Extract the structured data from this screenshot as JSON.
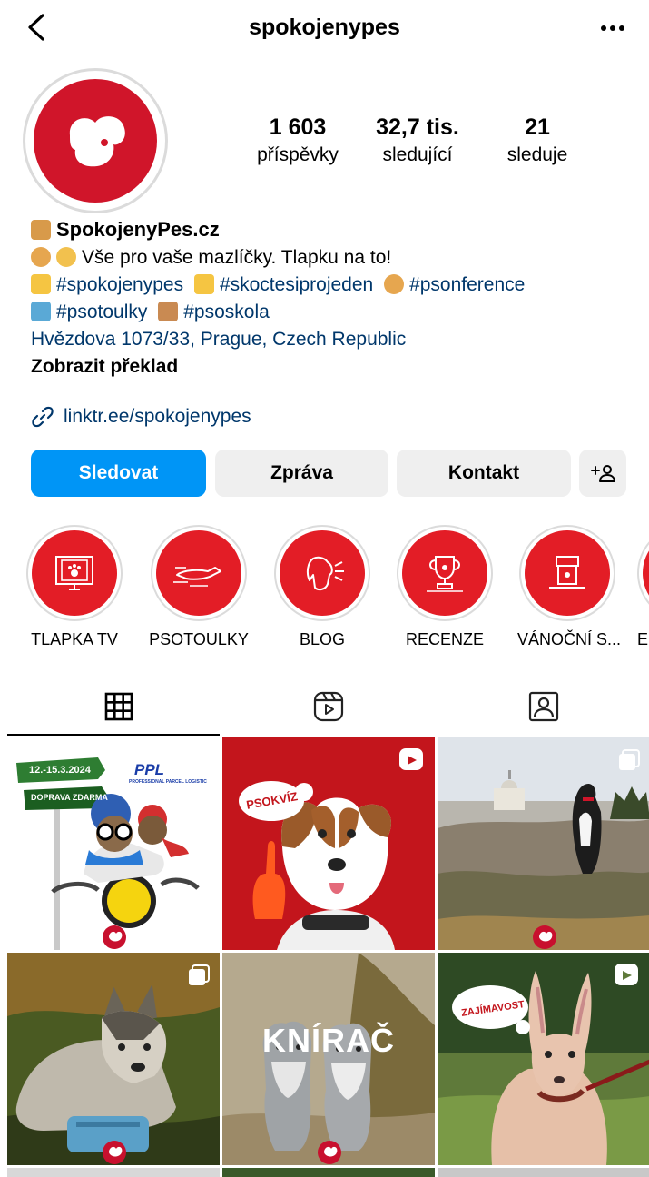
{
  "header": {
    "username": "spokojenypes"
  },
  "stats": [
    {
      "value": "1 603",
      "label": "příspěvky"
    },
    {
      "value": "32,7 tis.",
      "label": "sledující"
    },
    {
      "value": "21",
      "label": "sleduje"
    }
  ],
  "bio": {
    "name": "SpokojenyPes.cz",
    "line1": "Vše pro vaše mazlíčky. Tlapku na to!",
    "tag1": "#spokojenypes",
    "tag2": "#skoctesiprojeden",
    "tag3": "#psonference",
    "tag4": "#psotoulky",
    "tag5": "#psoskola",
    "address": "Hvězdova 1073/33, Prague, Czech Republic",
    "translate": "Zobrazit překlad",
    "link": "linktr.ee/spokojenypes"
  },
  "buttons": {
    "follow": "Sledovat",
    "message": "Zpráva",
    "contact": "Kontakt"
  },
  "highlights": [
    {
      "label": "TLAPKA TV",
      "icon": "tv-paw-icon"
    },
    {
      "label": "PSOTOULKY",
      "icon": "running-dog-icon"
    },
    {
      "label": "BLOG",
      "icon": "dog-head-icon"
    },
    {
      "label": "RECENZE",
      "icon": "trophy-icon"
    },
    {
      "label": "VÁNOČNÍ S...",
      "icon": "gift-box-icon"
    },
    {
      "label": "E",
      "icon": "partial-highlight-icon"
    }
  ],
  "tabs": [
    "grid-icon",
    "reels-icon",
    "tagged-icon"
  ],
  "posts": {
    "p1": {
      "date": "12.-15.3.2024",
      "shipping": "DOPRAVA ZDARMA",
      "brand": "PPL",
      "brand_sub": "PROFESSIONAL PARCEL LOGISTIC",
      "badge": "spokojený pes"
    },
    "p2": {
      "bubble": "PSOKVÍZ",
      "badge": "reel"
    },
    "p3": {
      "badge": "carousel"
    },
    "p4": {
      "badge": "carousel"
    },
    "p5": {
      "title": "KNÍRAČ"
    },
    "p6": {
      "bubble": "ZAJÍMAVOST",
      "badge": "reel"
    }
  },
  "colors": {
    "brand_red": "#d0152a",
    "follow_blue": "#0095f6",
    "link_blue": "#00376b"
  }
}
